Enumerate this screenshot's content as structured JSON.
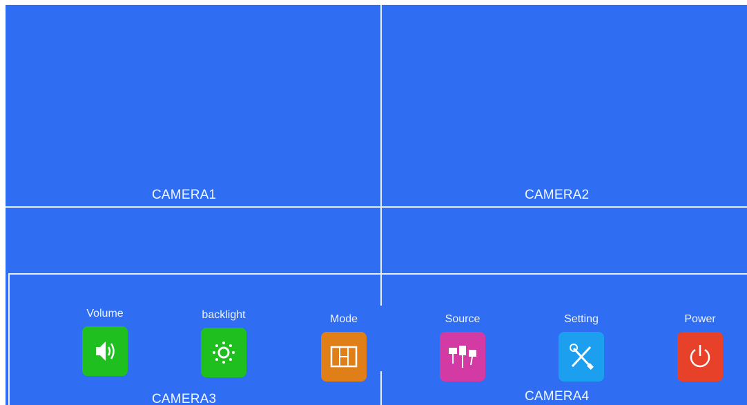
{
  "cameras": {
    "camera1": "CAMERA1",
    "camera2": "CAMERA2",
    "camera3": "CAMERA3",
    "camera4": "CAMERA4"
  },
  "menu": {
    "items": [
      {
        "label": "Volume",
        "icon": "speaker-icon",
        "color": "#1fbf1f"
      },
      {
        "label": "backlight",
        "icon": "sun-icon",
        "color": "#1fbf1f"
      },
      {
        "label": "Mode",
        "icon": "layout-icon",
        "color": "#e07f17"
      },
      {
        "label": "Source",
        "icon": "cables-icon",
        "color": "#d43aa3"
      },
      {
        "label": "Setting",
        "icon": "tools-icon",
        "color": "#1d9ff0"
      },
      {
        "label": "Power",
        "icon": "power-icon",
        "color": "#e84129"
      }
    ]
  },
  "colors": {
    "background": "#2f6df3",
    "grid_lines": "#e8eefc"
  }
}
